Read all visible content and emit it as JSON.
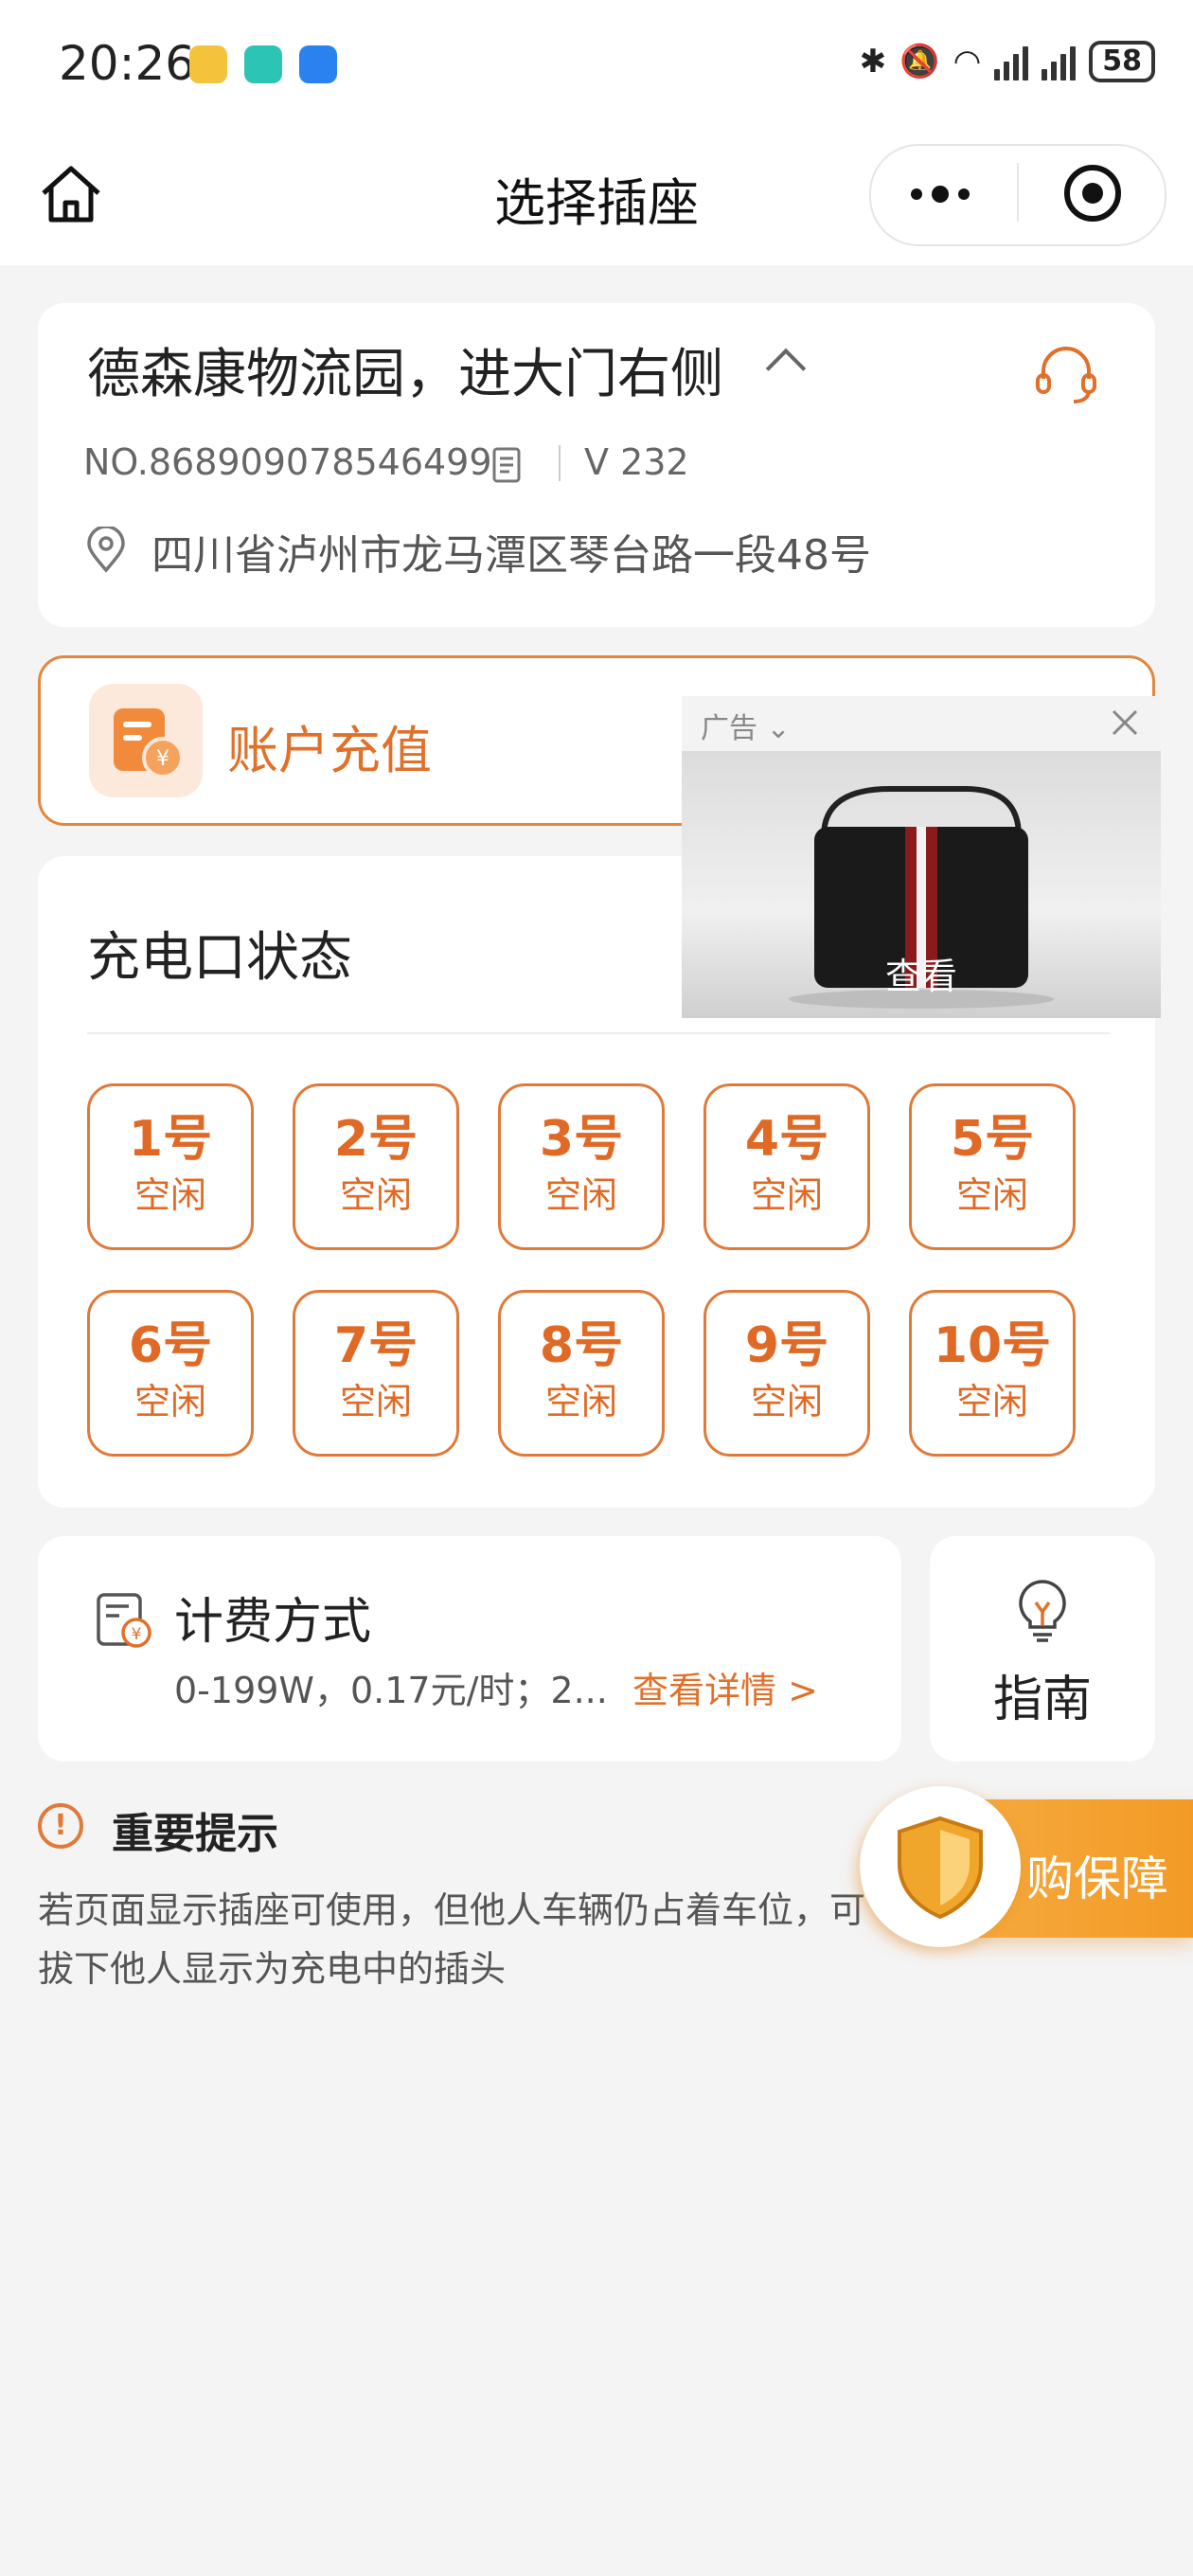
{
  "status_bar": {
    "time": "20:26",
    "battery": "58",
    "app_icon_colors": [
      "#f5c33b",
      "#2bc4b5",
      "#2a82f0"
    ]
  },
  "nav": {
    "title": "选择插座"
  },
  "station": {
    "name": "德森康物流园，进大门右侧",
    "device_no": "NO.868909078546499",
    "version": "V 232",
    "address": "四川省泸州市龙马潭区琴台路一段48号"
  },
  "recharge": {
    "label": "账户充值"
  },
  "ad": {
    "tag": "广告",
    "view_label": "查看"
  },
  "ports": {
    "title": "充电口状态",
    "items": [
      {
        "number": "1号",
        "status": "空闲"
      },
      {
        "number": "2号",
        "status": "空闲"
      },
      {
        "number": "3号",
        "status": "空闲"
      },
      {
        "number": "4号",
        "status": "空闲"
      },
      {
        "number": "5号",
        "status": "空闲"
      },
      {
        "number": "6号",
        "status": "空闲"
      },
      {
        "number": "7号",
        "status": "空闲"
      },
      {
        "number": "8号",
        "status": "空闲"
      },
      {
        "number": "9号",
        "status": "空闲"
      },
      {
        "number": "10号",
        "status": "空闲"
      }
    ]
  },
  "billing": {
    "title": "计费方式",
    "desc": "0-199W，0.17元/时；2...",
    "link": "查看详情 >"
  },
  "guide": {
    "label": "指南"
  },
  "notice": {
    "title": "重要提示",
    "text": "若页面显示插座可使用，但他人车辆仍占着车位，可拔下他人显示为充电中的插头"
  },
  "insurance": {
    "label": "购保障"
  },
  "colors": {
    "accent": "#e0712a",
    "background": "#f4f4f4"
  }
}
